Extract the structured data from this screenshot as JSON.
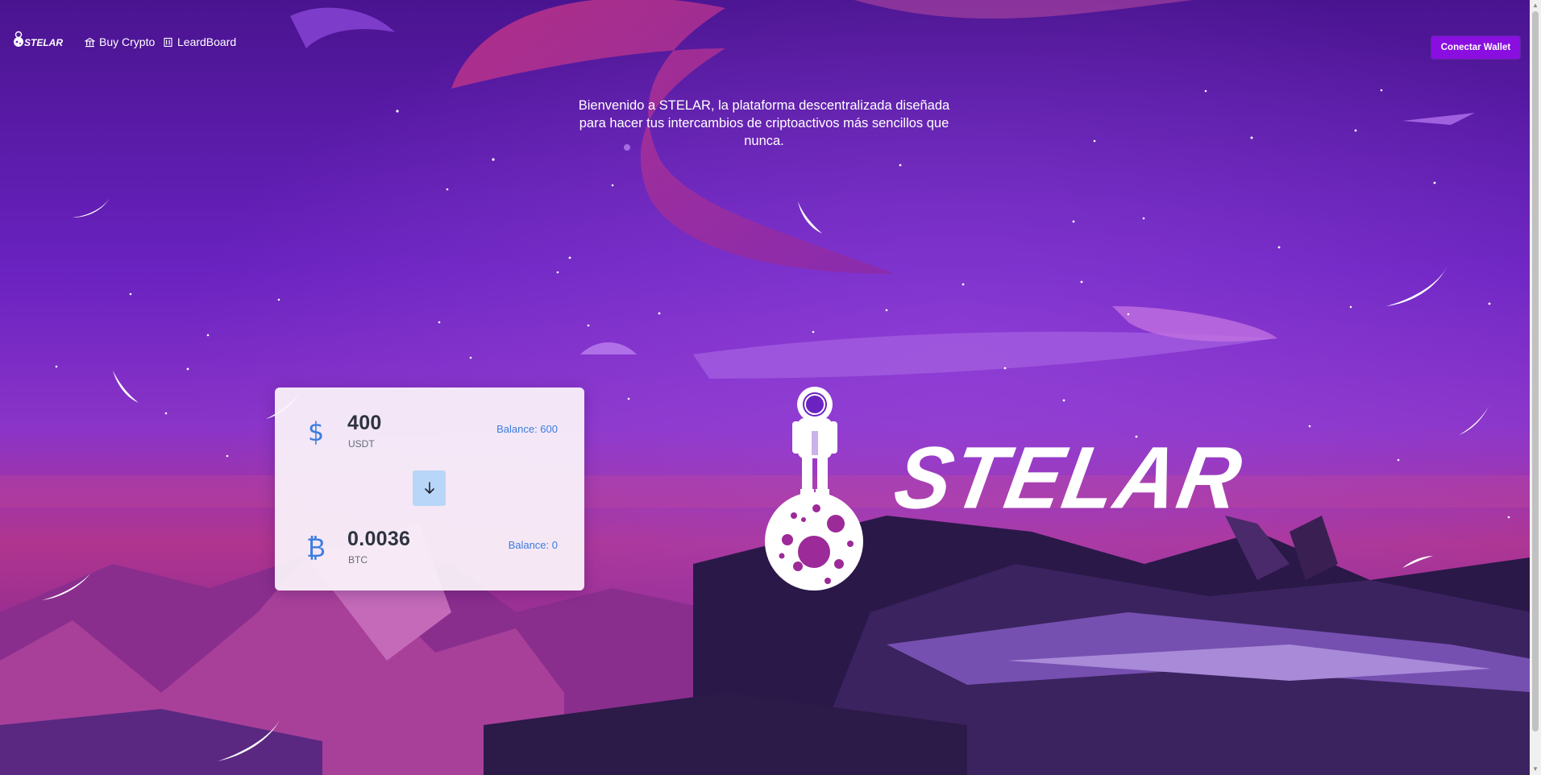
{
  "header": {
    "logo_text": "STELAR",
    "nav": [
      {
        "label": "Buy Crypto",
        "icon": "bank-icon"
      },
      {
        "label": "LeardBoard",
        "icon": "board-icon"
      }
    ],
    "connect_label": "Conectar Wallet"
  },
  "tagline": "Bienvenido a STELAR, la plataforma descentralizada diseñada para hacer tus intercambios de criptoactivos más sencillos que nunca.",
  "swap": {
    "from": {
      "amount": "400",
      "symbol": "USDT",
      "balance": "Balance: 600",
      "icon": "dollar-icon",
      "glyph": "$"
    },
    "to": {
      "amount": "0.0036",
      "symbol": "BTC",
      "balance": "Balance: 0",
      "icon": "bitcoin-icon",
      "glyph": "₿"
    },
    "swap_icon": "arrow-down-icon"
  },
  "hero": {
    "word": "STELAR"
  },
  "colors": {
    "accent": "#8a0ee0",
    "link_blue": "#3b7de0",
    "swap_button": "#b8d6f7",
    "sky_top": "#4b1593",
    "sky_mid": "#7b2ed0",
    "horizon": "#c0327e"
  }
}
